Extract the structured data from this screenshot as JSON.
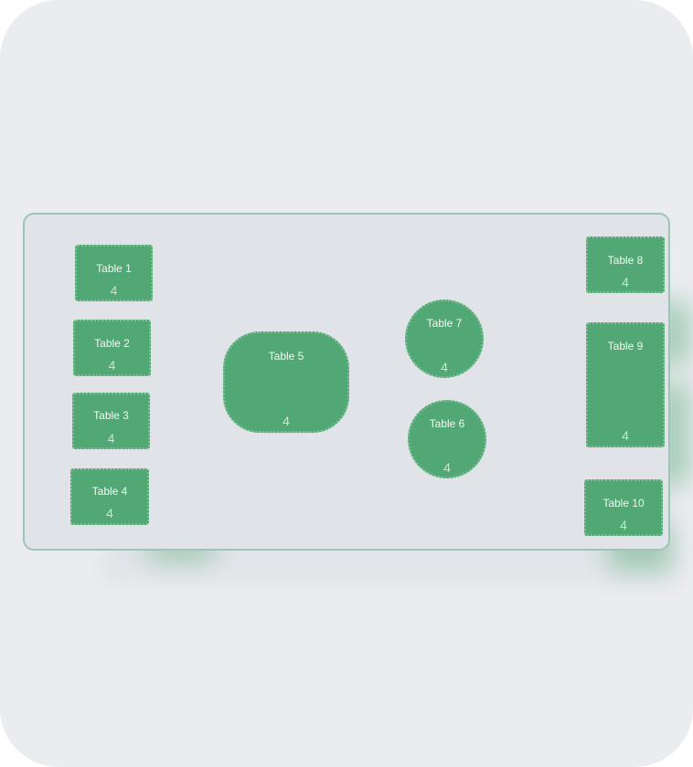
{
  "floor_plan": {
    "colors": {
      "table_fill": "#52a874",
      "floor_bg": "#e0e3e8",
      "floor_border": "#9cc5b4",
      "page_bg": "#ebecf0"
    },
    "tables": [
      {
        "name": "Table 1",
        "seats": "4",
        "shape": "rect"
      },
      {
        "name": "Table 2",
        "seats": "4",
        "shape": "rect"
      },
      {
        "name": "Table 3",
        "seats": "4",
        "shape": "rect"
      },
      {
        "name": "Table 4",
        "seats": "4",
        "shape": "rect"
      },
      {
        "name": "Table 5",
        "seats": "4",
        "shape": "rounded-rect"
      },
      {
        "name": "Table 6",
        "seats": "4",
        "shape": "circle"
      },
      {
        "name": "Table 7",
        "seats": "4",
        "shape": "circle"
      },
      {
        "name": "Table 8",
        "seats": "4",
        "shape": "rect"
      },
      {
        "name": "Table 9",
        "seats": "4",
        "shape": "rect"
      },
      {
        "name": "Table 10",
        "seats": "4",
        "shape": "rect"
      }
    ]
  }
}
